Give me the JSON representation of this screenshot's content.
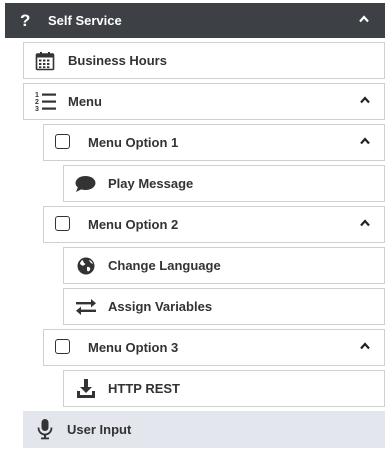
{
  "header": {
    "title": "Self Service",
    "icon": "question-icon"
  },
  "items": {
    "business_hours": {
      "label": "Business Hours",
      "icon": "calendar-icon"
    },
    "menu": {
      "label": "Menu",
      "icon": "numbered-list-icon"
    },
    "option1": {
      "label": "Menu Option 1",
      "icon": "checkbox-icon"
    },
    "play_message": {
      "label": "Play Message",
      "icon": "speech-bubble-icon"
    },
    "option2": {
      "label": "Menu Option 2",
      "icon": "checkbox-icon"
    },
    "change_language": {
      "label": "Change Language",
      "icon": "globe-icon"
    },
    "assign_variables": {
      "label": "Assign Variables",
      "icon": "swap-arrows-icon"
    },
    "option3": {
      "label": "Menu Option 3",
      "icon": "checkbox-icon"
    },
    "http_rest": {
      "label": "HTTP REST",
      "icon": "download-tray-icon"
    },
    "user_input": {
      "label": "User Input",
      "icon": "microphone-icon"
    }
  },
  "colors": {
    "header_bg": "#3d4045",
    "header_text": "#ffffff",
    "border": "#d0d0d0",
    "user_input_bg": "#e4e6ee"
  }
}
